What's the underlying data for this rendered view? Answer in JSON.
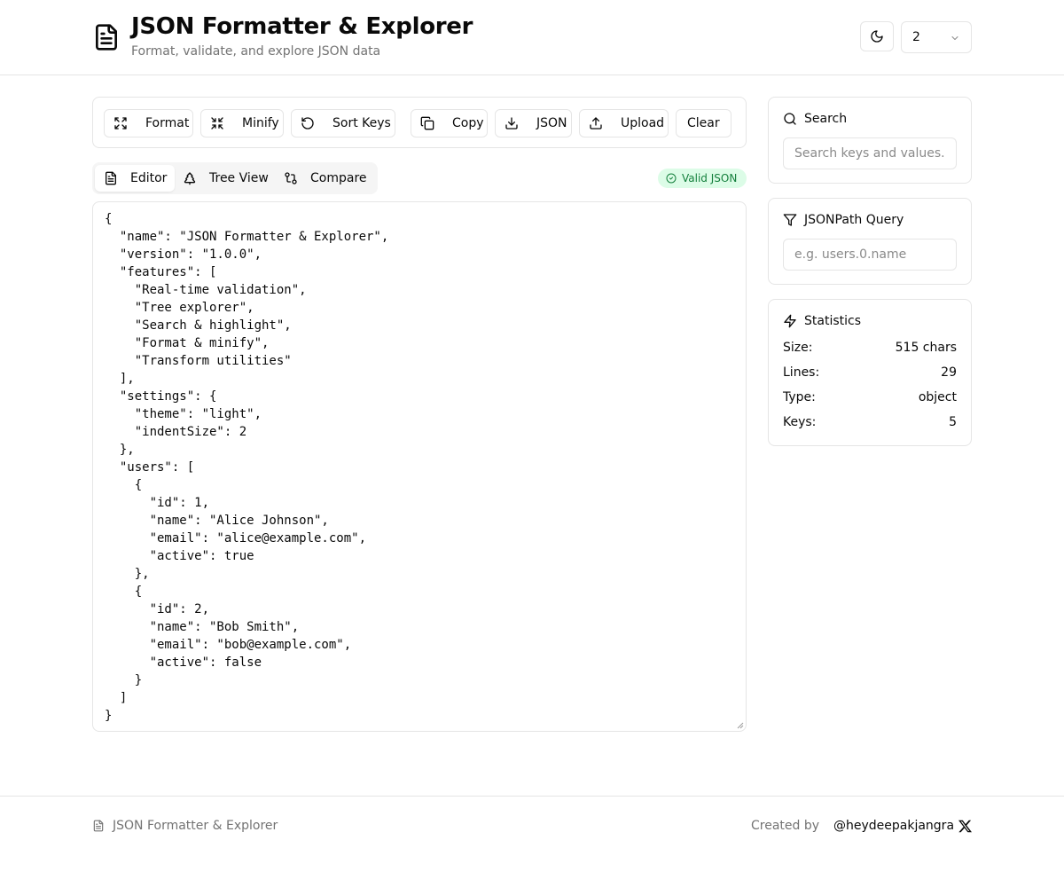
{
  "header": {
    "title": "JSON Formatter & Explorer",
    "subtitle": "Format, validate, and explore JSON data",
    "indent_value": "2"
  },
  "toolbar": {
    "format": "Format",
    "minify": "Minify",
    "sort_keys": "Sort Keys",
    "copy": "Copy",
    "download": "JSON",
    "upload": "Upload",
    "clear": "Clear"
  },
  "tabs": [
    {
      "label": "Editor",
      "active": true
    },
    {
      "label": "Tree View",
      "active": false
    },
    {
      "label": "Compare",
      "active": false
    }
  ],
  "status_badge": "Valid JSON",
  "editor": {
    "content": "{\n  \"name\": \"JSON Formatter & Explorer\",\n  \"version\": \"1.0.0\",\n  \"features\": [\n    \"Real-time validation\",\n    \"Tree explorer\",\n    \"Search & highlight\",\n    \"Format & minify\",\n    \"Transform utilities\"\n  ],\n  \"settings\": {\n    \"theme\": \"light\",\n    \"indentSize\": 2\n  },\n  \"users\": [\n    {\n      \"id\": 1,\n      \"name\": \"Alice Johnson\",\n      \"email\": \"alice@example.com\",\n      \"active\": true\n    },\n    {\n      \"id\": 2,\n      \"name\": \"Bob Smith\",\n      \"email\": \"bob@example.com\",\n      \"active\": false\n    }\n  ]\n}"
  },
  "search": {
    "title": "Search",
    "placeholder": "Search keys and values..."
  },
  "jsonpath": {
    "title": "JSONPath Query",
    "placeholder": "e.g. users.0.name"
  },
  "statistics": {
    "title": "Statistics",
    "rows": [
      {
        "label": "Size:",
        "value": "515 chars"
      },
      {
        "label": "Lines:",
        "value": "29"
      },
      {
        "label": "Type:",
        "value": "object"
      },
      {
        "label": "Keys:",
        "value": "5"
      }
    ]
  },
  "footer": {
    "brand": "JSON Formatter & Explorer",
    "created_by": "Created by",
    "author": "@heydeepakjangra"
  },
  "colors": {
    "border": "#e5e5e5",
    "muted_text": "#737373",
    "valid_bg": "#dcfce7",
    "valid_text": "#15803d"
  },
  "icons": {
    "logo": "file-text-icon",
    "theme": "moon-icon",
    "format": "expand-icon",
    "minify": "shrink-icon",
    "sort_keys": "rotate-ccw-icon",
    "copy": "copy-icon",
    "download": "download-icon",
    "upload": "upload-icon",
    "tab_editor": "file-text-icon",
    "tab_tree": "tree-icon",
    "tab_compare": "git-compare-icon",
    "valid": "check-circle-icon",
    "search": "search-icon",
    "jsonpath": "filter-icon",
    "statistics": "zap-icon",
    "footer_x": "x-logo-icon"
  }
}
